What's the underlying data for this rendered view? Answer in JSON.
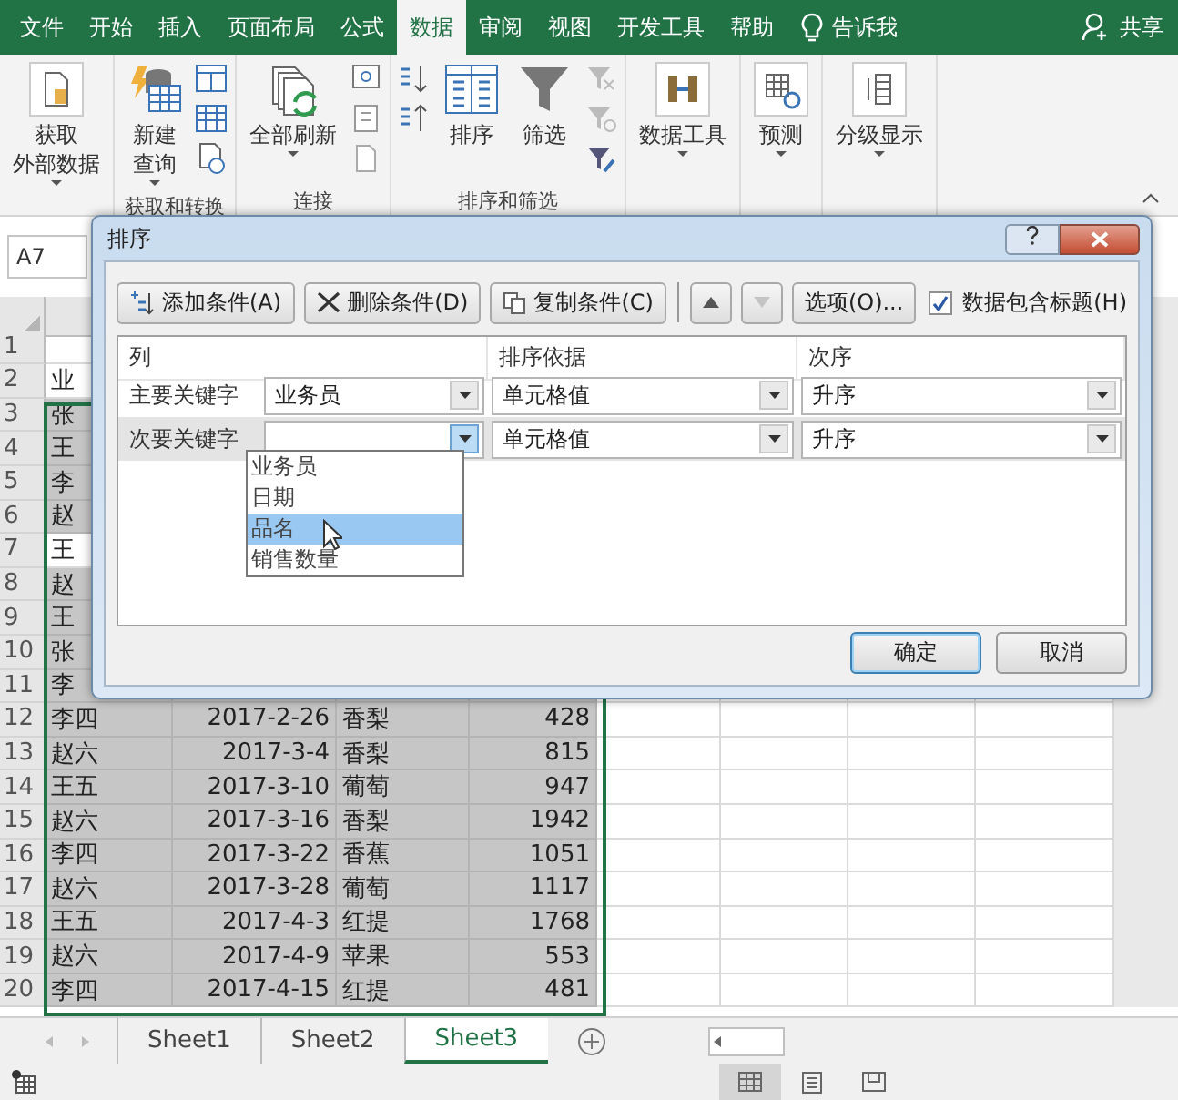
{
  "ribbon_tabs": [
    {
      "label": "文件",
      "selected": false
    },
    {
      "label": "开始",
      "selected": false
    },
    {
      "label": "插入",
      "selected": false
    },
    {
      "label": "页面布局",
      "selected": false
    },
    {
      "label": "公式",
      "selected": false
    },
    {
      "label": "数据",
      "selected": true
    },
    {
      "label": "审阅",
      "selected": false
    },
    {
      "label": "视图",
      "selected": false
    },
    {
      "label": "开发工具",
      "selected": false
    },
    {
      "label": "帮助",
      "selected": false
    }
  ],
  "tell_me": "告诉我",
  "share": "共享",
  "ribbon_groups": [
    {
      "kind": "get-data",
      "buttons": [
        {
          "lines": [
            "获取",
            "外部数据"
          ],
          "dropdown": true
        }
      ]
    },
    {
      "kind": "get-transform",
      "label": "获取和转换",
      "buttons": [
        {
          "lines": [
            "新建",
            "查询"
          ],
          "dropdown": true
        }
      ]
    },
    {
      "kind": "connections",
      "label": "连接",
      "buttons": [
        {
          "lines": [
            "全部刷新"
          ],
          "dropdown": true
        }
      ]
    },
    {
      "kind": "sort-filter",
      "label": "排序和筛选",
      "buttons": [
        {
          "lines": [
            "排序"
          ],
          "dropdown": false
        },
        {
          "lines": [
            "筛选"
          ],
          "dropdown": false
        }
      ]
    },
    {
      "kind": "data-tools",
      "buttons": [
        {
          "lines": [
            "数据工具"
          ],
          "dropdown": true
        }
      ]
    },
    {
      "kind": "forecast",
      "buttons": [
        {
          "lines": [
            "预测"
          ],
          "dropdown": true
        }
      ]
    },
    {
      "kind": "outline",
      "buttons": [
        {
          "lines": [
            "分级显示"
          ],
          "dropdown": true
        }
      ]
    }
  ],
  "name_box": "A7",
  "rows": [
    {
      "number": "1",
      "cells": [],
      "selected": false,
      "active": false
    },
    {
      "number": "2",
      "cells": [
        "业"
      ],
      "selected": false,
      "active": false
    },
    {
      "number": "3",
      "cells": [
        "张"
      ],
      "selected": true,
      "active": false
    },
    {
      "number": "4",
      "cells": [
        "王"
      ],
      "selected": true,
      "active": false
    },
    {
      "number": "5",
      "cells": [
        "李"
      ],
      "selected": true,
      "active": false
    },
    {
      "number": "6",
      "cells": [
        "赵"
      ],
      "selected": true,
      "active": false
    },
    {
      "number": "7",
      "cells": [
        "王"
      ],
      "selected": true,
      "active": true
    },
    {
      "number": "8",
      "cells": [
        "赵"
      ],
      "selected": true,
      "active": false
    },
    {
      "number": "9",
      "cells": [
        "王"
      ],
      "selected": true,
      "active": false
    },
    {
      "number": "10",
      "cells": [
        "张"
      ],
      "selected": true,
      "active": false
    },
    {
      "number": "11",
      "cells": [
        "李"
      ],
      "selected": true,
      "active": false
    },
    {
      "number": "12",
      "cells": [
        "李四",
        "2017-2-26",
        "香梨",
        "428"
      ],
      "selected": true,
      "active": false
    },
    {
      "number": "13",
      "cells": [
        "赵六",
        "2017-3-4",
        "香梨",
        "815"
      ],
      "selected": true,
      "active": false
    },
    {
      "number": "14",
      "cells": [
        "王五",
        "2017-3-10",
        "葡萄",
        "947"
      ],
      "selected": true,
      "active": false
    },
    {
      "number": "15",
      "cells": [
        "赵六",
        "2017-3-16",
        "香梨",
        "1942"
      ],
      "selected": true,
      "active": false
    },
    {
      "number": "16",
      "cells": [
        "李四",
        "2017-3-22",
        "香蕉",
        "1051"
      ],
      "selected": true,
      "active": false
    },
    {
      "number": "17",
      "cells": [
        "赵六",
        "2017-3-28",
        "葡萄",
        "1117"
      ],
      "selected": true,
      "active": false
    },
    {
      "number": "18",
      "cells": [
        "王五",
        "2017-4-3",
        "红提",
        "1768"
      ],
      "selected": true,
      "active": false
    },
    {
      "number": "19",
      "cells": [
        "赵六",
        "2017-4-9",
        "苹果",
        "553"
      ],
      "selected": true,
      "active": false
    },
    {
      "number": "20",
      "cells": [
        "李四",
        "2017-4-15",
        "红提",
        "481"
      ],
      "selected": true,
      "active": false
    }
  ],
  "sheet_tabs": [
    {
      "label": "Sheet1",
      "selected": false
    },
    {
      "label": "Sheet2",
      "selected": false
    },
    {
      "label": "Sheet3",
      "selected": true
    }
  ],
  "status_views": [
    {
      "kind": "normal",
      "selected": true
    },
    {
      "kind": "page-layout",
      "selected": false
    },
    {
      "kind": "page-break",
      "selected": false
    }
  ],
  "dialog": {
    "title": "排序",
    "toolbar": [
      {
        "kind": "add",
        "label": "添加条件(A)",
        "disabled": false
      },
      {
        "kind": "delete",
        "label": "删除条件(D)",
        "disabled": false
      },
      {
        "kind": "copy",
        "label": "复制条件(C)",
        "disabled": false
      },
      {
        "kind": "up",
        "disabled": false
      },
      {
        "kind": "down",
        "disabled": true
      },
      {
        "kind": "text",
        "label": "选项(O)...",
        "disabled": false
      }
    ],
    "header_checkbox": {
      "label": "数据包含标题(H)",
      "checked": true
    },
    "columns": [
      "列",
      "排序依据",
      "次序"
    ],
    "levels": [
      {
        "label": "主要关键字",
        "column": "业务员",
        "sort_on": "单元格值",
        "order": "升序",
        "selected": false,
        "open": false
      },
      {
        "label": "次要关键字",
        "sort_on": "单元格值",
        "order": "升序",
        "selected": true,
        "open": true
      }
    ],
    "dropdown_options": [
      {
        "label": "业务员",
        "selected": false
      },
      {
        "label": "日期",
        "selected": false
      },
      {
        "label": "品名",
        "selected": true
      },
      {
        "label": "销售数量",
        "selected": false
      }
    ],
    "buttons": [
      {
        "label": "确定",
        "default": true
      },
      {
        "label": "取消",
        "default": false
      }
    ]
  }
}
